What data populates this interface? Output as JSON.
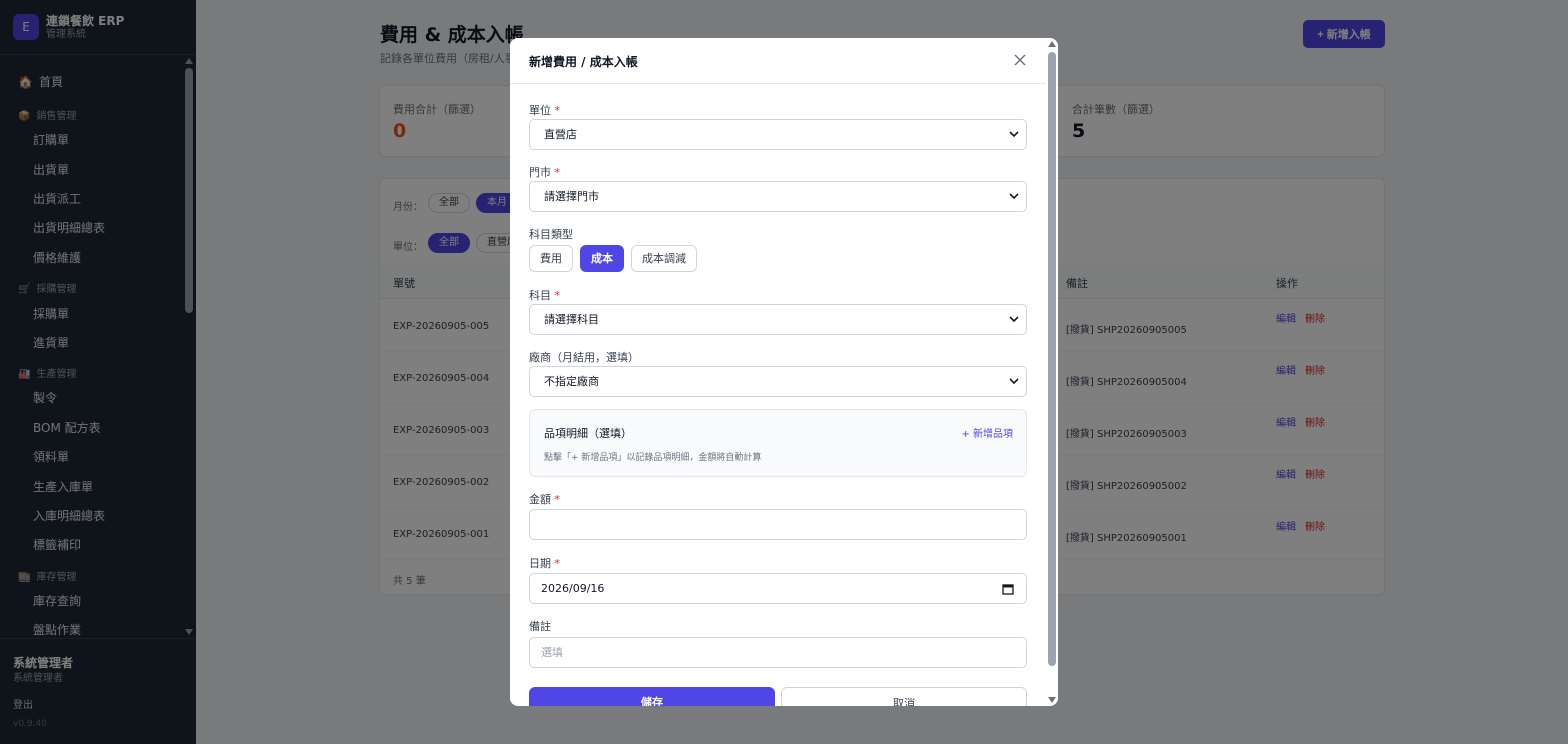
{
  "sidebar": {
    "brand_letter": "E",
    "brand_title": "連鎖餐飲 ERP",
    "brand_subtitle": "管理系統",
    "home": "首頁",
    "groups": {
      "sales": "銷售管理",
      "purchase": "採購管理",
      "production": "生產管理",
      "inventory": "庫存管理"
    },
    "items": {
      "order": "訂購單",
      "shipment": "出貨單",
      "dispatch": "出貨派工",
      "shipment_detail": "出貨明細總表",
      "price": "價格維護",
      "purchase_order": "採購單",
      "receiving": "進貨單",
      "work_order": "製令",
      "bom": "BOM 配方表",
      "material_issue": "領料單",
      "production_in": "生產入庫單",
      "in_detail": "入庫明細總表",
      "label_reprint": "標籤補印",
      "stock_query": "庫存查詢",
      "stocktake": "盤點作業"
    },
    "user_name": "系統管理者",
    "user_role": "系統管理者",
    "logout": "登出",
    "version": "v0.9.40"
  },
  "page": {
    "title": "費用 & 成本入帳",
    "description": "記錄各單位費用（房租/人事",
    "new_button": "+ 新增入帳",
    "stats": {
      "total_label": "費用合計（篩選）",
      "total_value": "0",
      "count_label": "合計筆數（篩選）",
      "count_value": "5"
    },
    "filters": {
      "month_label": "月份：",
      "month_all": "全部",
      "month_current": "本月",
      "unit_label": "單位：",
      "unit_all": "全部",
      "unit_direct": "直營店"
    },
    "table": {
      "headers": {
        "no": "單號",
        "note": "備註",
        "action": "操作"
      },
      "rows": [
        {
          "no": "EXP-20260905-005",
          "note": "[撥貨] SHP20260905005"
        },
        {
          "no": "EXP-20260905-004",
          "note": "[撥貨] SHP20260905004"
        },
        {
          "no": "EXP-20260905-003",
          "note": "[撥貨] SHP20260905003"
        },
        {
          "no": "EXP-20260905-002",
          "note": "[撥貨] SHP20260905002"
        },
        {
          "no": "EXP-20260905-001",
          "note": "[撥貨] SHP20260905001"
        }
      ],
      "edit_label": "編輯",
      "delete_label": "刪除",
      "footer": "共 5 筆"
    }
  },
  "modal": {
    "title": "新增費用 / 成本入帳",
    "required_mark": "*",
    "unit_label": "單位",
    "unit_value": "直營店",
    "store_label": "門市",
    "store_value": "請選擇門市",
    "type_label": "科目類型",
    "types": [
      "費用",
      "成本",
      "成本調減"
    ],
    "active_type": "成本",
    "subject_label": "科目",
    "subject_value": "請選擇科目",
    "vendor_label": "廠商（月結用，選填）",
    "vendor_value": "不指定廠商",
    "items_title": "品項明細（選填）",
    "items_add": "+ 新增品項",
    "items_hint": "點擊「+ 新增品項」以記錄品項明細，金額將自動計算",
    "amount_label": "金額",
    "amount_value": "",
    "date_label": "日期",
    "date_value": "2026/09/16",
    "note_label": "備註",
    "note_placeholder": "選填",
    "save_label": "儲存",
    "cancel_label": "取消"
  }
}
